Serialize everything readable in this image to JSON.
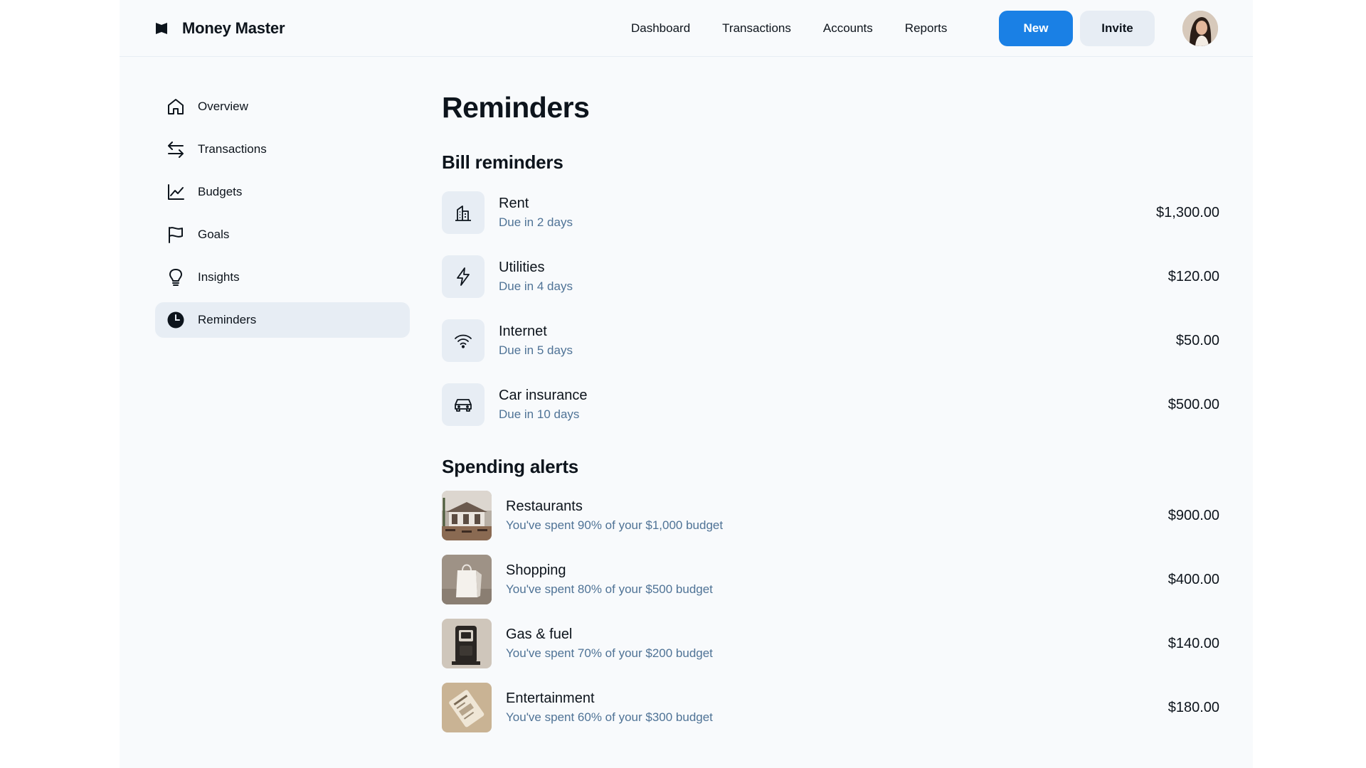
{
  "app": {
    "name": "Money Master"
  },
  "topnav": {
    "items": [
      "Dashboard",
      "Transactions",
      "Accounts",
      "Reports"
    ],
    "new_label": "New",
    "invite_label": "Invite"
  },
  "sidebar": {
    "items": [
      {
        "label": "Overview",
        "icon": "home-icon"
      },
      {
        "label": "Transactions",
        "icon": "arrows-swap-icon"
      },
      {
        "label": "Budgets",
        "icon": "trend-chart-icon"
      },
      {
        "label": "Goals",
        "icon": "flag-icon"
      },
      {
        "label": "Insights",
        "icon": "lightbulb-icon"
      },
      {
        "label": "Reminders",
        "icon": "clock-icon",
        "active": true
      }
    ]
  },
  "page": {
    "title": "Reminders"
  },
  "bill_reminders": {
    "title": "Bill reminders",
    "items": [
      {
        "name": "Rent",
        "due": "Due in 2 days",
        "amount": "$1,300.00",
        "icon": "building-icon"
      },
      {
        "name": "Utilities",
        "due": "Due in 4 days",
        "amount": "$120.00",
        "icon": "lightning-icon"
      },
      {
        "name": "Internet",
        "due": "Due in 5 days",
        "amount": "$50.00",
        "icon": "wifi-icon"
      },
      {
        "name": "Car insurance",
        "due": "Due in 10 days",
        "amount": "$500.00",
        "icon": "car-icon"
      }
    ]
  },
  "spending_alerts": {
    "title": "Spending alerts",
    "items": [
      {
        "name": "Restaurants",
        "message": "You've spent 90% of your $1,000 budget",
        "amount": "$900.00",
        "image": "restaurant-photo"
      },
      {
        "name": "Shopping",
        "message": "You've spent 80% of your $500 budget",
        "amount": "$400.00",
        "image": "shopping-bag-photo"
      },
      {
        "name": "Gas & fuel",
        "message": "You've spent 70% of your $200 budget",
        "amount": "$140.00",
        "image": "gas-pump-photo"
      },
      {
        "name": "Entertainment",
        "message": "You've spent 60% of your $300 budget",
        "amount": "$180.00",
        "image": "ticket-photo"
      }
    ]
  },
  "colors": {
    "accent": "#1a80e5",
    "secondary_text": "#4f7396",
    "chip_bg": "#e7edf4",
    "background": "#f8fafc"
  }
}
